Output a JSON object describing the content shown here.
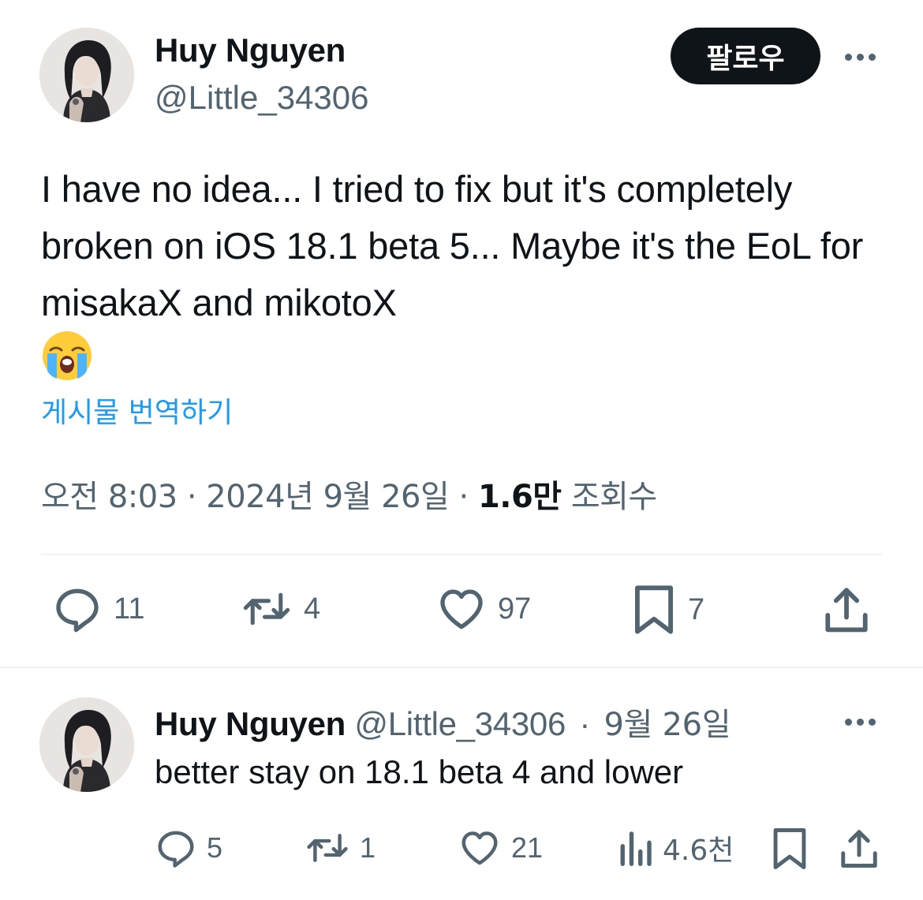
{
  "main_tweet": {
    "author_name": "Huy Nguyen",
    "author_handle": "@Little_34306",
    "follow_label": "팔로우",
    "text": "I have no idea... I tried to fix but it's completely broken on iOS 18.1 beta 5... Maybe it's the EoL for misakaX and mikotoX",
    "emoji": "crying-face",
    "translate_label": "게시물 번역하기",
    "time": "오전 8:03",
    "date": "2024년 9월 26일",
    "views_count": "1.6만",
    "views_label": "조회수",
    "replies": "11",
    "reposts": "4",
    "likes": "97",
    "bookmarks": "7"
  },
  "reply_tweet": {
    "author_name": "Huy Nguyen",
    "author_handle": "@Little_34306",
    "date": "9월 26일",
    "text": "better stay on 18.1 beta 4 and lower",
    "replies": "5",
    "reposts": "1",
    "likes": "21",
    "views": "4.6천"
  },
  "colors": {
    "accent": "#1d9bf0",
    "text_primary": "#0f1419",
    "text_secondary": "#536471",
    "divider": "#eff3f4"
  }
}
